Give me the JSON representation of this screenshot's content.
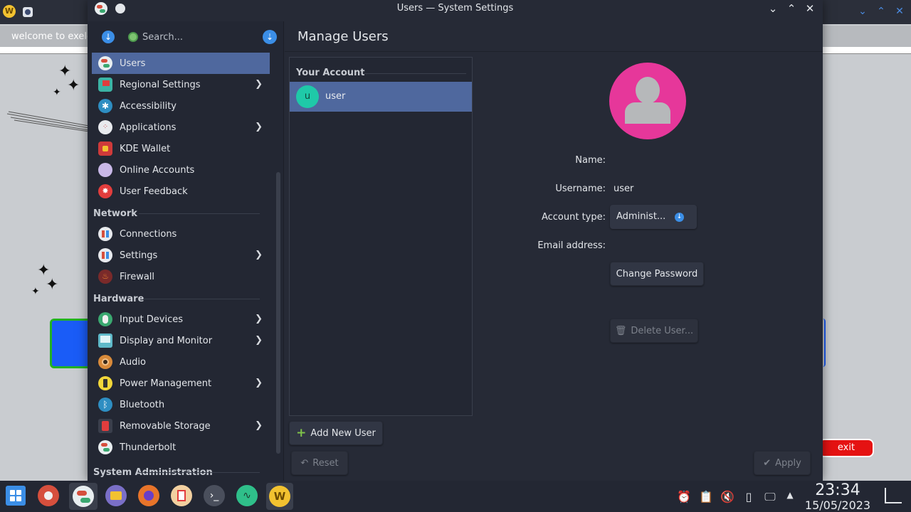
{
  "desktop": {
    "welcome_text": "welcome to exele",
    "exit_label": "exit"
  },
  "window": {
    "title": "Users — System Settings"
  },
  "sidebar": {
    "search_placeholder": "Search...",
    "items": [
      {
        "label": "Users",
        "icon": "users-icon",
        "active": true
      },
      {
        "label": "Regional Settings",
        "icon": "flag-icon",
        "chevron": true
      },
      {
        "label": "Accessibility",
        "icon": "accessibility-icon"
      },
      {
        "label": "Applications",
        "icon": "applications-icon",
        "chevron": true
      },
      {
        "label": "KDE Wallet",
        "icon": "wallet-icon"
      },
      {
        "label": "Online Accounts",
        "icon": "cloud-icon"
      },
      {
        "label": "User Feedback",
        "icon": "feedback-icon"
      }
    ],
    "network_heading": "Network",
    "network_items": [
      {
        "label": "Connections",
        "icon": "connections-icon"
      },
      {
        "label": "Settings",
        "icon": "network-settings-icon",
        "chevron": true
      },
      {
        "label": "Firewall",
        "icon": "firewall-icon"
      }
    ],
    "hardware_heading": "Hardware",
    "hardware_items": [
      {
        "label": "Input Devices",
        "icon": "input-devices-icon",
        "chevron": true
      },
      {
        "label": "Display and Monitor",
        "icon": "monitor-icon",
        "chevron": true
      },
      {
        "label": "Audio",
        "icon": "audio-icon"
      },
      {
        "label": "Power Management",
        "icon": "battery-icon",
        "chevron": true
      },
      {
        "label": "Bluetooth",
        "icon": "bluetooth-icon"
      },
      {
        "label": "Removable Storage",
        "icon": "usb-icon",
        "chevron": true
      },
      {
        "label": "Thunderbolt",
        "icon": "thunderbolt-icon"
      }
    ],
    "sysadmin_heading": "System Administration"
  },
  "main": {
    "page_title": "Manage Users",
    "your_account_heading": "Your Account",
    "users": [
      {
        "initial": "u",
        "name": "user"
      }
    ],
    "form": {
      "name_label": "Name:",
      "name_value": "",
      "username_label": "Username:",
      "username_value": "user",
      "account_type_label": "Account type:",
      "account_type_value": "Administ...",
      "email_label": "Email address:",
      "email_value": "",
      "change_password_label": "Change Password",
      "delete_user_label": "Delete User..."
    },
    "add_user_label": "Add New User",
    "reset_label": "Reset",
    "apply_label": "Apply"
  },
  "taskbar": {
    "time": "23:34",
    "date": "15/05/2023"
  },
  "colors": {
    "accent": "#4f689e",
    "avatar_pink": "#e6379a",
    "user_avatar_teal": "#1fc9a8",
    "exit_red": "#e51212"
  }
}
